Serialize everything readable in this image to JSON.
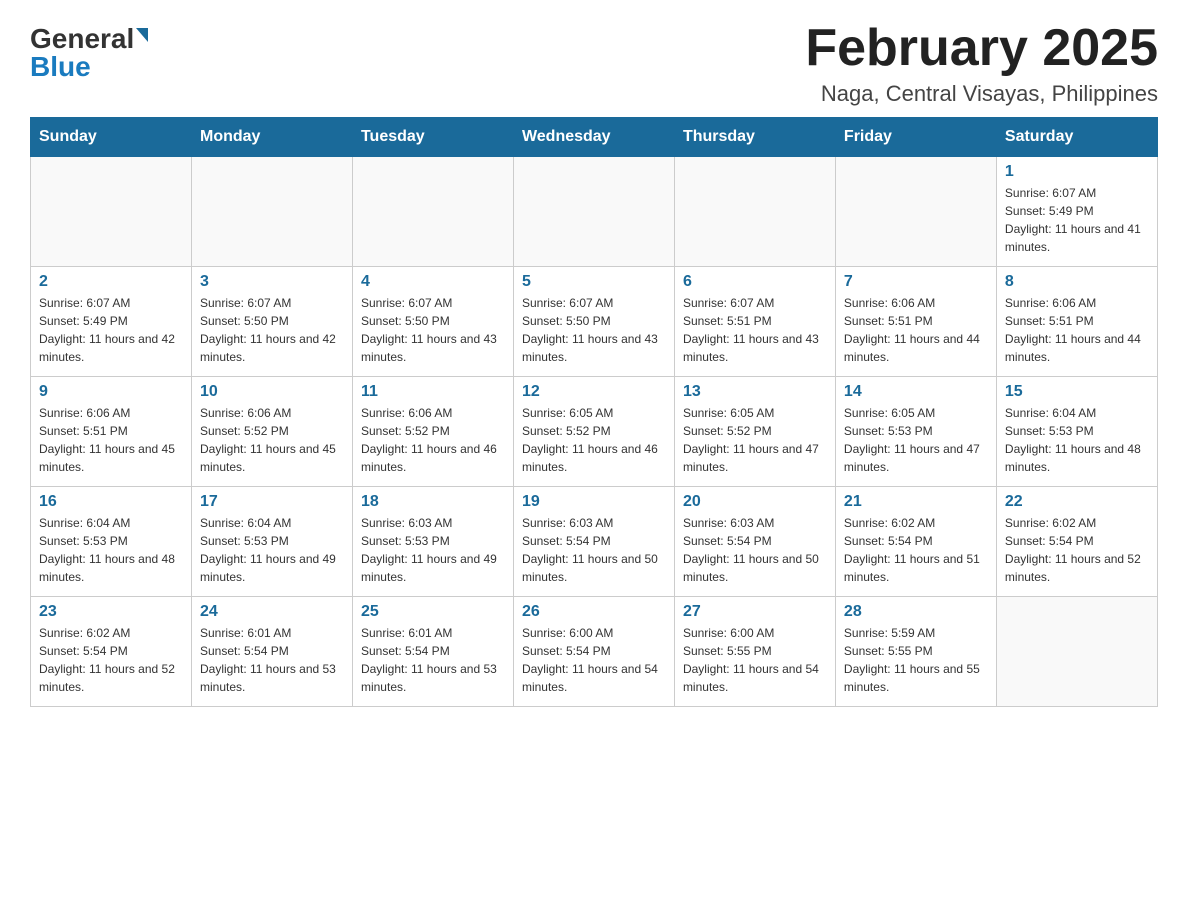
{
  "header": {
    "logo_text_general": "General",
    "logo_text_blue": "Blue",
    "month_title": "February 2025",
    "location": "Naga, Central Visayas, Philippines"
  },
  "days_of_week": [
    "Sunday",
    "Monday",
    "Tuesday",
    "Wednesday",
    "Thursday",
    "Friday",
    "Saturday"
  ],
  "weeks": [
    {
      "days": [
        {
          "num": "",
          "sunrise": "",
          "sunset": "",
          "daylight": ""
        },
        {
          "num": "",
          "sunrise": "",
          "sunset": "",
          "daylight": ""
        },
        {
          "num": "",
          "sunrise": "",
          "sunset": "",
          "daylight": ""
        },
        {
          "num": "",
          "sunrise": "",
          "sunset": "",
          "daylight": ""
        },
        {
          "num": "",
          "sunrise": "",
          "sunset": "",
          "daylight": ""
        },
        {
          "num": "",
          "sunrise": "",
          "sunset": "",
          "daylight": ""
        },
        {
          "num": "1",
          "sunrise": "Sunrise: 6:07 AM",
          "sunset": "Sunset: 5:49 PM",
          "daylight": "Daylight: 11 hours and 41 minutes."
        }
      ]
    },
    {
      "days": [
        {
          "num": "2",
          "sunrise": "Sunrise: 6:07 AM",
          "sunset": "Sunset: 5:49 PM",
          "daylight": "Daylight: 11 hours and 42 minutes."
        },
        {
          "num": "3",
          "sunrise": "Sunrise: 6:07 AM",
          "sunset": "Sunset: 5:50 PM",
          "daylight": "Daylight: 11 hours and 42 minutes."
        },
        {
          "num": "4",
          "sunrise": "Sunrise: 6:07 AM",
          "sunset": "Sunset: 5:50 PM",
          "daylight": "Daylight: 11 hours and 43 minutes."
        },
        {
          "num": "5",
          "sunrise": "Sunrise: 6:07 AM",
          "sunset": "Sunset: 5:50 PM",
          "daylight": "Daylight: 11 hours and 43 minutes."
        },
        {
          "num": "6",
          "sunrise": "Sunrise: 6:07 AM",
          "sunset": "Sunset: 5:51 PM",
          "daylight": "Daylight: 11 hours and 43 minutes."
        },
        {
          "num": "7",
          "sunrise": "Sunrise: 6:06 AM",
          "sunset": "Sunset: 5:51 PM",
          "daylight": "Daylight: 11 hours and 44 minutes."
        },
        {
          "num": "8",
          "sunrise": "Sunrise: 6:06 AM",
          "sunset": "Sunset: 5:51 PM",
          "daylight": "Daylight: 11 hours and 44 minutes."
        }
      ]
    },
    {
      "days": [
        {
          "num": "9",
          "sunrise": "Sunrise: 6:06 AM",
          "sunset": "Sunset: 5:51 PM",
          "daylight": "Daylight: 11 hours and 45 minutes."
        },
        {
          "num": "10",
          "sunrise": "Sunrise: 6:06 AM",
          "sunset": "Sunset: 5:52 PM",
          "daylight": "Daylight: 11 hours and 45 minutes."
        },
        {
          "num": "11",
          "sunrise": "Sunrise: 6:06 AM",
          "sunset": "Sunset: 5:52 PM",
          "daylight": "Daylight: 11 hours and 46 minutes."
        },
        {
          "num": "12",
          "sunrise": "Sunrise: 6:05 AM",
          "sunset": "Sunset: 5:52 PM",
          "daylight": "Daylight: 11 hours and 46 minutes."
        },
        {
          "num": "13",
          "sunrise": "Sunrise: 6:05 AM",
          "sunset": "Sunset: 5:52 PM",
          "daylight": "Daylight: 11 hours and 47 minutes."
        },
        {
          "num": "14",
          "sunrise": "Sunrise: 6:05 AM",
          "sunset": "Sunset: 5:53 PM",
          "daylight": "Daylight: 11 hours and 47 minutes."
        },
        {
          "num": "15",
          "sunrise": "Sunrise: 6:04 AM",
          "sunset": "Sunset: 5:53 PM",
          "daylight": "Daylight: 11 hours and 48 minutes."
        }
      ]
    },
    {
      "days": [
        {
          "num": "16",
          "sunrise": "Sunrise: 6:04 AM",
          "sunset": "Sunset: 5:53 PM",
          "daylight": "Daylight: 11 hours and 48 minutes."
        },
        {
          "num": "17",
          "sunrise": "Sunrise: 6:04 AM",
          "sunset": "Sunset: 5:53 PM",
          "daylight": "Daylight: 11 hours and 49 minutes."
        },
        {
          "num": "18",
          "sunrise": "Sunrise: 6:03 AM",
          "sunset": "Sunset: 5:53 PM",
          "daylight": "Daylight: 11 hours and 49 minutes."
        },
        {
          "num": "19",
          "sunrise": "Sunrise: 6:03 AM",
          "sunset": "Sunset: 5:54 PM",
          "daylight": "Daylight: 11 hours and 50 minutes."
        },
        {
          "num": "20",
          "sunrise": "Sunrise: 6:03 AM",
          "sunset": "Sunset: 5:54 PM",
          "daylight": "Daylight: 11 hours and 50 minutes."
        },
        {
          "num": "21",
          "sunrise": "Sunrise: 6:02 AM",
          "sunset": "Sunset: 5:54 PM",
          "daylight": "Daylight: 11 hours and 51 minutes."
        },
        {
          "num": "22",
          "sunrise": "Sunrise: 6:02 AM",
          "sunset": "Sunset: 5:54 PM",
          "daylight": "Daylight: 11 hours and 52 minutes."
        }
      ]
    },
    {
      "days": [
        {
          "num": "23",
          "sunrise": "Sunrise: 6:02 AM",
          "sunset": "Sunset: 5:54 PM",
          "daylight": "Daylight: 11 hours and 52 minutes."
        },
        {
          "num": "24",
          "sunrise": "Sunrise: 6:01 AM",
          "sunset": "Sunset: 5:54 PM",
          "daylight": "Daylight: 11 hours and 53 minutes."
        },
        {
          "num": "25",
          "sunrise": "Sunrise: 6:01 AM",
          "sunset": "Sunset: 5:54 PM",
          "daylight": "Daylight: 11 hours and 53 minutes."
        },
        {
          "num": "26",
          "sunrise": "Sunrise: 6:00 AM",
          "sunset": "Sunset: 5:54 PM",
          "daylight": "Daylight: 11 hours and 54 minutes."
        },
        {
          "num": "27",
          "sunrise": "Sunrise: 6:00 AM",
          "sunset": "Sunset: 5:55 PM",
          "daylight": "Daylight: 11 hours and 54 minutes."
        },
        {
          "num": "28",
          "sunrise": "Sunrise: 5:59 AM",
          "sunset": "Sunset: 5:55 PM",
          "daylight": "Daylight: 11 hours and 55 minutes."
        },
        {
          "num": "",
          "sunrise": "",
          "sunset": "",
          "daylight": ""
        }
      ]
    }
  ]
}
